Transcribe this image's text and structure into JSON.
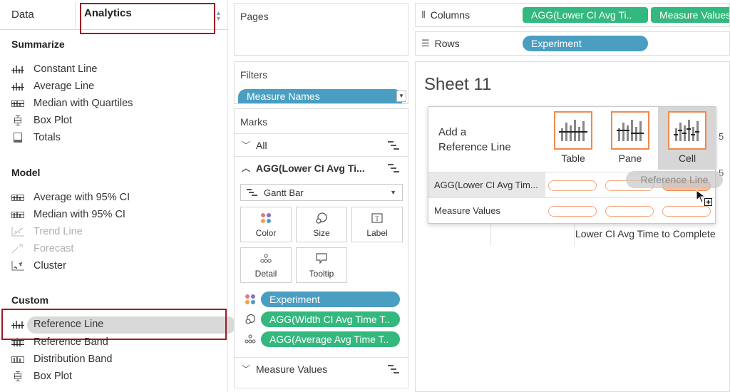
{
  "left_pane": {
    "tabs": {
      "data": "Data",
      "analytics": "Analytics"
    },
    "sections": [
      {
        "title": "Summarize",
        "items": [
          {
            "label": "Constant Line",
            "icon": "reference-line-icon",
            "enabled": true
          },
          {
            "label": "Average Line",
            "icon": "reference-line-icon",
            "enabled": true
          },
          {
            "label": "Median with Quartiles",
            "icon": "distribution-band-icon",
            "enabled": true
          },
          {
            "label": "Box Plot",
            "icon": "box-plot-icon",
            "enabled": true
          },
          {
            "label": "Totals",
            "icon": "totals-icon",
            "enabled": true
          }
        ]
      },
      {
        "title": "Model",
        "items": [
          {
            "label": "Average with 95% CI",
            "icon": "distribution-band-icon",
            "enabled": true
          },
          {
            "label": "Median with 95% CI",
            "icon": "distribution-band-icon",
            "enabled": true
          },
          {
            "label": "Trend Line",
            "icon": "trend-line-icon",
            "enabled": false
          },
          {
            "label": "Forecast",
            "icon": "forecast-icon",
            "enabled": false
          },
          {
            "label": "Cluster",
            "icon": "cluster-icon",
            "enabled": true
          }
        ]
      },
      {
        "title": "Custom",
        "items": [
          {
            "label": "Reference Line",
            "icon": "reference-line-icon",
            "enabled": true,
            "selected": true
          },
          {
            "label": "Reference Band",
            "icon": "reference-band-icon",
            "enabled": true
          },
          {
            "label": "Distribution Band",
            "icon": "distribution-band-icon",
            "enabled": true
          },
          {
            "label": "Box Plot",
            "icon": "box-plot-icon",
            "enabled": true
          }
        ]
      }
    ]
  },
  "middle_pane": {
    "pages_title": "Pages",
    "filters_title": "Filters",
    "filter_pill": "Measure Names",
    "marks_title": "Marks",
    "marks_all": "All",
    "marks_measure": "AGG(Lower CI Avg Ti...",
    "mark_type": "Gantt Bar",
    "mark_buttons": {
      "color": "Color",
      "size": "Size",
      "label": "Label",
      "detail": "Detail",
      "tooltip": "Tooltip"
    },
    "mark_pills": [
      {
        "label": "Experiment",
        "icon": "color-icon",
        "color": "#4a9ec2"
      },
      {
        "label": "AGG(Width CI Avg Time T..",
        "icon": "size-icon",
        "color": "#33b87e"
      },
      {
        "label": "AGG(Average Avg Time T..",
        "icon": "detail-icon",
        "color": "#33b87e"
      }
    ],
    "measure_values": "Measure Values"
  },
  "right_pane": {
    "columns_label": "Columns",
    "columns_pills": [
      "AGG(Lower CI Avg Ti..",
      "Measure Values"
    ],
    "rows_label": "Rows",
    "rows_pills": [
      "Experiment"
    ],
    "sheet_title": "Sheet 11",
    "axis_title": "Lower CI Avg Time to Complete",
    "tick_label": "5"
  },
  "popup": {
    "title_line1": "Add a",
    "title_line2": "Reference Line",
    "scopes": [
      {
        "label": "Table"
      },
      {
        "label": "Pane"
      },
      {
        "label": "Cell",
        "highlighted": true
      }
    ],
    "rows": [
      {
        "label": "AGG(Lower CI Avg Tim..."
      },
      {
        "label": "Measure Values"
      }
    ],
    "drag_ghost": "Reference Line"
  },
  "colors": {
    "accent_blue_pill": "#4a9ec2",
    "accent_green_pill": "#33b87e",
    "scope_border": "#f08a4b",
    "highlight_box": "#9e1b24"
  }
}
